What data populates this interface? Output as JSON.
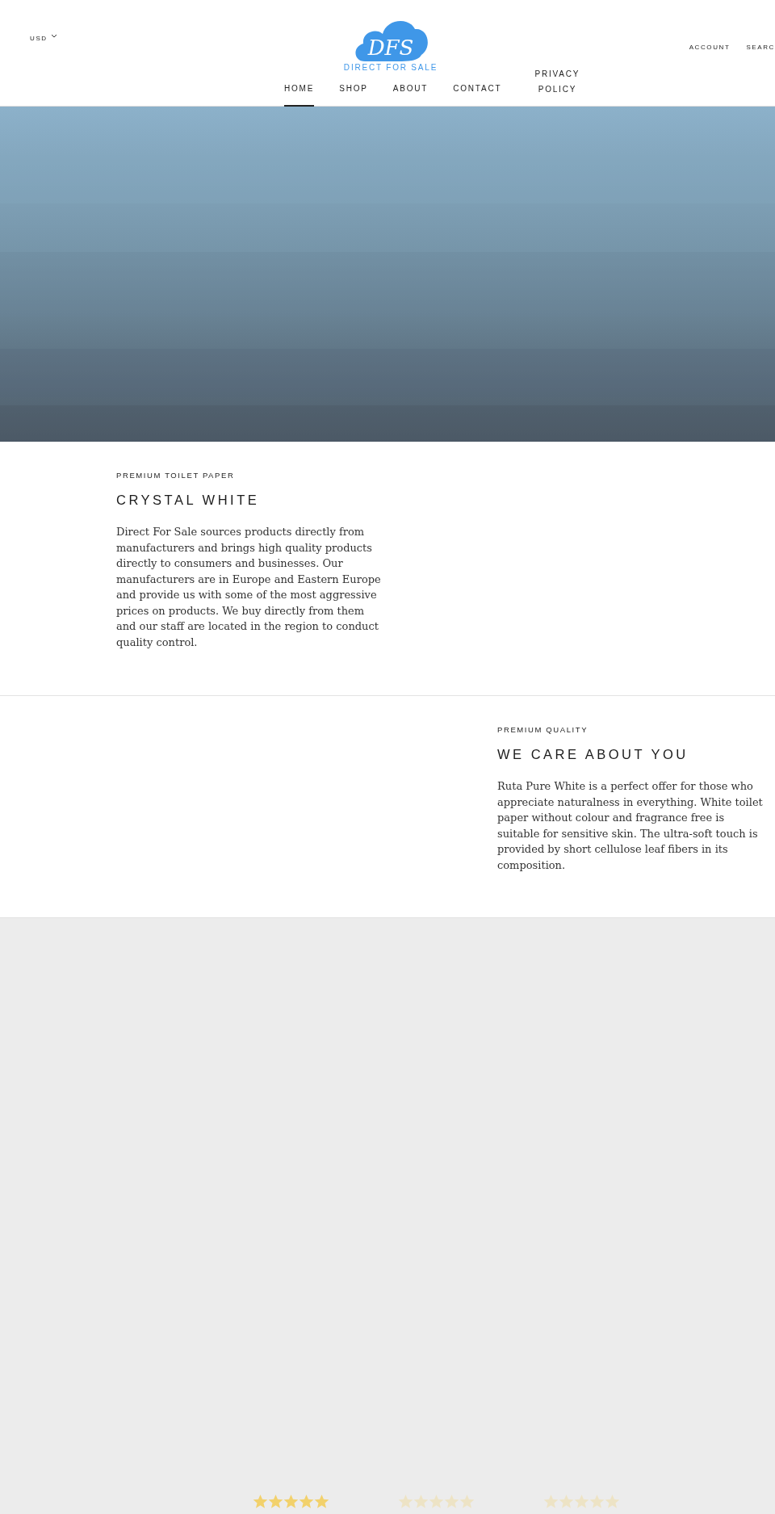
{
  "header": {
    "currency": "USD",
    "logo": {
      "mark": "DFS",
      "name": "DIRECT FOR SALE"
    },
    "nav": [
      {
        "label": "HOME",
        "selected": true
      },
      {
        "label": "SHOP",
        "selected": false
      },
      {
        "label": "ABOUT",
        "selected": false
      },
      {
        "label": "CONTACT",
        "selected": false
      },
      {
        "label": "PRIVACY POLICY",
        "selected": false
      }
    ],
    "actions": [
      "ACCOUNT",
      "SEARC"
    ]
  },
  "sections": [
    {
      "eyebrow": "PREMIUM TOILET PAPER",
      "title": "CRYSTAL WHITE",
      "text": "Direct For Sale sources products directly from manufacturers and brings high quality products directly to consumers and businesses. Our manufacturers are in Europe and Eastern Europe and provide us with some of the most aggressive prices on products. We buy directly from them and our staff are located in the region to conduct quality control.",
      "kind": "left"
    },
    {
      "eyebrow": "PREMIUM QUALITY",
      "title": "WE CARE ABOUT YOU",
      "text": "Ruta Pure White is a perfect offer for those who appreciate naturalness in everything. White toilet paper without colour and fragrance free is suitable for sensitive skin. The ultra-soft touch is provided by short cellulose leaf fibers in its composition.",
      "kind": "right"
    }
  ],
  "reviews": [
    {
      "stars": 5,
      "selected": true
    },
    {
      "stars": 5,
      "selected": false
    },
    {
      "stars": 5,
      "selected": false
    }
  ]
}
